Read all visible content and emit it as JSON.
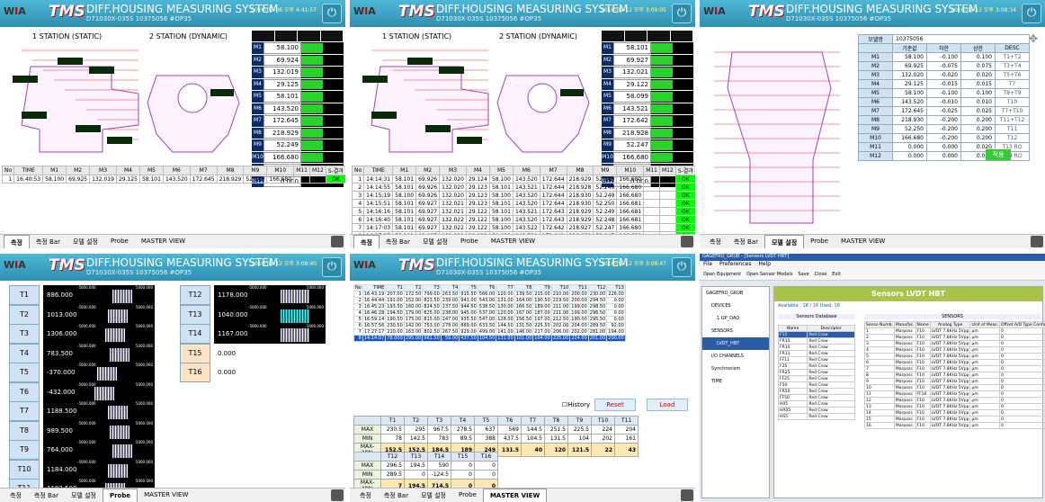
{
  "app": {
    "logo": "WIA",
    "tms": "TMS",
    "title": "DIFF.HOUSING MEASURING SYSTEM",
    "subtitle": "D71030X-035S 10375056 #OP35",
    "power": "⏻"
  },
  "tabs": [
    "측정",
    "측정 Bar",
    "모델 설정",
    "Probe",
    "MASTER VIEW"
  ],
  "p1": {
    "datetime": "2016-02-06 오후 4:41:57",
    "station1": "1 STATION (STATIC)",
    "station2": "2 STATION (DYNAMIC)",
    "mlabels": [
      "M1",
      "M2",
      "M3",
      "M4",
      "M5",
      "M6",
      "M7",
      "M8",
      "M9",
      "M10",
      "M11",
      "M12"
    ],
    "mvalues": [
      "58.100",
      "69.924",
      "132.019",
      "29.125",
      "58.101",
      "143.520",
      "172.645",
      "218.929",
      "52.249",
      "166.680",
      "0.000",
      "0.000"
    ],
    "fill": [
      0.5,
      0.5,
      0.5,
      0.5,
      0.5,
      0.5,
      0.5,
      0.5,
      0.5,
      0.5,
      0,
      0
    ],
    "hdr": [
      "No",
      "TIME",
      "M1",
      "M2",
      "M3",
      "M4",
      "M5",
      "M6",
      "M7",
      "M8",
      "M9",
      "M10",
      "M11",
      "M12",
      "S-결과",
      "D-결과"
    ],
    "rows": [
      [
        "1",
        "16:40:53",
        "58.100",
        "69.925",
        "132.019",
        "29.125",
        "58.101",
        "143.520",
        "172.645",
        "218.929",
        "52.249",
        "166.680",
        "",
        "",
        "OK",
        ""
      ]
    ]
  },
  "p2": {
    "datetime": "2016-02-12 오후 3:09:05",
    "station1": "1 STATION (STATIC)",
    "station2": "2 STATION (DYNAMIC)",
    "mvalues": [
      "58.101",
      "69.927",
      "132.021",
      "29.122",
      "58.099",
      "143.521",
      "172.642",
      "218.928",
      "52.247",
      "166.680",
      "0.000",
      "0.000"
    ],
    "fill": [
      0.5,
      0.5,
      0.5,
      0.5,
      0.5,
      0.5,
      0.5,
      0.5,
      0.5,
      0.5,
      0,
      0
    ],
    "hdr": [
      "No",
      "TIME",
      "M1",
      "M2",
      "M3",
      "M4",
      "M5",
      "M6",
      "M7",
      "M8",
      "M9",
      "M10",
      "M11",
      "M12",
      "S-결과",
      "D-결과"
    ],
    "rows": [
      [
        "1",
        "14:14:31",
        "58.101",
        "69.926",
        "132.020",
        "29.124",
        "58.100",
        "143.520",
        "172.644",
        "218.929",
        "52.249",
        "166.680",
        "",
        "",
        "OK",
        ""
      ],
      [
        "2",
        "14:14:55",
        "58.101",
        "69.926",
        "132.020",
        "29.123",
        "58.101",
        "143.521",
        "172.644",
        "218.928",
        "52.249",
        "166.680",
        "",
        "",
        "OK",
        ""
      ],
      [
        "3",
        "14:15:19",
        "58.100",
        "69.926",
        "132.020",
        "29.123",
        "58.100",
        "143.520",
        "172.644",
        "218.930",
        "52.249",
        "166.680",
        "",
        "",
        "OK",
        ""
      ],
      [
        "4",
        "14:15:51",
        "58.101",
        "69.927",
        "132.021",
        "29.123",
        "58.101",
        "143.520",
        "172.644",
        "218.930",
        "52.250",
        "166.681",
        "",
        "",
        "OK",
        ""
      ],
      [
        "5",
        "14:16:16",
        "58.101",
        "69.927",
        "132.021",
        "29.122",
        "58.101",
        "143.521",
        "172.643",
        "218.929",
        "52.249",
        "166.681",
        "",
        "",
        "OK",
        ""
      ],
      [
        "6",
        "14:16:40",
        "58.101",
        "69.927",
        "132.022",
        "29.122",
        "58.100",
        "143.520",
        "172.643",
        "218.929",
        "52.248",
        "166.681",
        "",
        "",
        "OK",
        ""
      ],
      [
        "7",
        "14:17:03",
        "58.101",
        "69.927",
        "132.022",
        "29.122",
        "58.100",
        "143.522",
        "172.642",
        "218.927",
        "52.247",
        "166.680",
        "",
        "",
        "OK",
        ""
      ],
      [
        "8",
        "14:17:27",
        "58.101",
        "69.927",
        "132.021",
        "29.122",
        "58.099",
        "143.521",
        "172.642",
        "218.928",
        "52.247",
        "166.680",
        "",
        "",
        "OK",
        ""
      ]
    ]
  },
  "p3": {
    "datetime": "2016-02-12 오후 3:08:34",
    "model_label": "모델명",
    "model": "10375056",
    "hdr": [
      "",
      "기준값",
      "하한",
      "상한",
      "DESC"
    ],
    "rows": [
      [
        "M1",
        "58.100",
        "-0.100",
        "0.100",
        "T1+T2"
      ],
      [
        "M2",
        "69.925",
        "-0.075",
        "0.075",
        "T3+T4"
      ],
      [
        "M3",
        "132.020",
        "-0.020",
        "0.020",
        "T5+T6"
      ],
      [
        "M4",
        "29.125",
        "-0.015",
        "0.015",
        "T7"
      ],
      [
        "M5",
        "58.100",
        "-0.100",
        "0.100",
        "T8+T9"
      ],
      [
        "M6",
        "143.520",
        "-0.010",
        "0.010",
        "T10"
      ],
      [
        "M7",
        "172.645",
        "-0.025",
        "0.025",
        "T7+T10"
      ],
      [
        "M8",
        "218.930",
        "-0.200",
        "0.200",
        "T11+T12"
      ],
      [
        "M9",
        "52.250",
        "-0.200",
        "0.200",
        "T11"
      ],
      [
        "M10",
        "166.680",
        "-0.200",
        "0.200",
        "T12"
      ],
      [
        "M11",
        "0.000",
        "0.000",
        "0.020",
        "T13 RO"
      ],
      [
        "M12",
        "0.000",
        "0.000",
        "0.020",
        "T14 RO"
      ]
    ],
    "apply": "적용"
  },
  "p4": {
    "datetime": "2016-02-12 오후 3:08:40",
    "scale_min": "-5000.000",
    "scale_max": "5000.000",
    "probes": [
      [
        "T1",
        "886.000"
      ],
      [
        "T2",
        "1013.000"
      ],
      [
        "T3",
        "1306.000"
      ],
      [
        "T4",
        "783.500"
      ],
      [
        "T5",
        "-370.000"
      ],
      [
        "T6",
        "-432.000"
      ],
      [
        "T7",
        "1188.500"
      ],
      [
        "T8",
        "989.500"
      ],
      [
        "T9",
        "764.000"
      ],
      [
        "T10",
        "1184.000"
      ],
      [
        "T11",
        "1183.500"
      ]
    ],
    "probes2": [
      [
        "T12",
        "1178.000"
      ],
      [
        "T13",
        "1040.000"
      ],
      [
        "T14",
        "1167.000"
      ],
      [
        "T15",
        "0.000"
      ],
      [
        "T16",
        "0.000"
      ]
    ]
  },
  "p5": {
    "datetime": "2016-02-12 오후 3:09:47",
    "hdr": [
      "No",
      "TIME",
      "T1",
      "T2",
      "T3",
      "T4",
      "T5",
      "T6",
      "T7",
      "T8",
      "T9",
      "T10",
      "T11",
      "T12",
      "T13"
    ],
    "rows": [
      [
        "1",
        "16:43:19",
        "207.00",
        "172.50",
        "799.00",
        "263.50",
        "915.50",
        "566.00",
        "120.00",
        "139.50",
        "215.00",
        "210.00",
        "200.00",
        "230.00",
        "226.00"
      ],
      [
        "2",
        "16:44:44",
        "191.00",
        "152.00",
        "823.50",
        "239.00",
        "941.00",
        "543.00",
        "131.00",
        "164.00",
        "190.50",
        "219.50",
        "200.00",
        "294.50",
        "0.00"
      ],
      [
        "3",
        "16:45:23",
        "193.50",
        "160.00",
        "824.50",
        "237.50",
        "944.50",
        "538.50",
        "130.00",
        "166.50",
        "189.00",
        "211.00",
        "199.00",
        "298.50",
        "0.00"
      ],
      [
        "4",
        "16:46:28",
        "194.50",
        "179.00",
        "825.00",
        "238.00",
        "945.00",
        "537.00",
        "120.00",
        "167.00",
        "187.00",
        "211.00",
        "199.00",
        "296.50",
        "0.00"
      ],
      [
        "5",
        "16:59:14",
        "190.50",
        "175.00",
        "815.00",
        "247.00",
        "935.50",
        "547.00",
        "128.00",
        "156.50",
        "197.00",
        "212.50",
        "190.00",
        "295.50",
        "0.00"
      ],
      [
        "6",
        "16:57:56",
        "230.50",
        "142.00",
        "753.00",
        "278.00",
        "889.00",
        "633.50",
        "144.50",
        "131.50",
        "225.50",
        "202.00",
        "204.00",
        "289.50",
        "92.00"
      ],
      [
        "7",
        "17:27:17",
        "210.00",
        "163.00",
        "802.50",
        "267.50",
        "929.00",
        "499.00",
        "141.00",
        "146.00",
        "217.00",
        "206.00",
        "202.00",
        "281.00",
        "194.00"
      ],
      [
        "8",
        "14:14:07",
        "78.000",
        "295.00",
        "961.50",
        "59.00",
        "437.50",
        "104.50",
        "131.00",
        "101.00",
        "104.00",
        "225.00",
        "224.00",
        "201.00",
        "200.00"
      ]
    ],
    "history": "History",
    "reset": "Reset",
    "load": "Load",
    "stat_hdr": [
      "",
      "T1",
      "T2",
      "T3",
      "T4",
      "T5",
      "T6",
      "T7",
      "T8",
      "T9",
      "T10",
      "T11"
    ],
    "stat": [
      [
        "MAX",
        "230.5",
        "295",
        "967.5",
        "278.5",
        "637",
        "569",
        "144.5",
        "251.5",
        "225.5",
        "224",
        "204"
      ],
      [
        "MIN",
        "78",
        "142.5",
        "783",
        "89.5",
        "388",
        "437.5",
        "104.5",
        "131.5",
        "104",
        "202",
        "161"
      ],
      [
        "MAX-MIN",
        "152.5",
        "152.5",
        "184.5",
        "189",
        "249",
        "131.5",
        "40",
        "120",
        "121.5",
        "22",
        "43"
      ]
    ],
    "stat2_hdr": [
      "",
      "T12",
      "T13",
      "T14",
      "T15",
      "T16"
    ],
    "stat2": [
      [
        "MAX",
        "296.5",
        "194.5",
        "590",
        "0",
        "0"
      ],
      [
        "MIN",
        "289.5",
        "0",
        "-124.5",
        "0",
        "0"
      ],
      [
        "MAX-MIN",
        "7",
        "194.5",
        "714.5",
        "0",
        "0"
      ]
    ]
  },
  "p6": {
    "window_title": "GAGEFRO_GRUB - [Sensors LVDT HBT]",
    "menu": [
      "File",
      "Preferences",
      "Help"
    ],
    "toolbar": [
      "Open Equipment",
      "Open Sensor Models",
      "Save",
      "Close",
      "Exit"
    ],
    "tree": [
      "GAGEFRO_GRUB",
      "DEVICES",
      "1 GP_DAQ",
      "SENSORS",
      "LVDT_HBT",
      "I/O CHANNELS",
      "Synchronism",
      "TIME"
    ],
    "title": "Sensors LVDT HBT",
    "available": "Available : 18 / 16 Used: 16",
    "db_title": "Sensors Database",
    "db_hdr": [
      "Name",
      "Descriptor"
    ],
    "db_rows": [
      [
        "F15",
        "Red Crow"
      ],
      [
        "FR15",
        "Red Crow"
      ],
      [
        "FR10",
        "Red Crow"
      ],
      [
        "FR11",
        "Red Crow"
      ],
      [
        "FF11",
        "Red Crow"
      ],
      [
        "F25",
        "Red Crow"
      ],
      [
        "FR25",
        "Red Crow"
      ],
      [
        "FF25",
        "Red Crow"
      ],
      [
        "F50",
        "Red Crow"
      ],
      [
        "FR50",
        "Red Crow"
      ],
      [
        "FF50",
        "Red Crow"
      ],
      [
        "H05",
        "Red Crow"
      ],
      [
        "HR05",
        "Red Crow"
      ],
      [
        "HS5",
        "Red Crow"
      ]
    ],
    "s_title": "SENSORS",
    "s_hdr": [
      "Senso Numb.",
      "Manufac.",
      "Name",
      "Analog Type",
      "Unit of Meas.",
      "Offset A/D Type Config.",
      "Gain Adj.",
      "Ann. Parts"
    ],
    "s_rows": [
      [
        "1",
        "Marposs",
        "F10",
        "LVDT 7.8KHz 5Vpp",
        "μm",
        "0",
        "1",
        "1"
      ],
      [
        "2",
        "Marposs",
        "F10",
        "LVDT 7.8KHz 5Vpp",
        "μm",
        "0",
        "1",
        "1"
      ],
      [
        "3",
        "Marposs",
        "F10",
        "LVDT 7.8KHz 5Vpp",
        "μm",
        "0",
        "1",
        "1"
      ],
      [
        "4",
        "Marposs",
        "F10",
        "LVDT 7.8KHz 5Vpp",
        "μm",
        "0",
        "1",
        "1"
      ],
      [
        "5",
        "Marposs",
        "F10",
        "LVDT 7.8KHz 5Vpp",
        "μm",
        "0",
        "1",
        "1"
      ],
      [
        "6",
        "Marposs",
        "F10",
        "LVDT 7.8KHz 5Vpp",
        "μm",
        "0",
        "1",
        "1"
      ],
      [
        "7",
        "Marposs",
        "F10",
        "LVDT 7.8KHz 5Vpp",
        "μm",
        "0",
        "1",
        "1"
      ],
      [
        "8",
        "Marposs",
        "F10",
        "LVDT 7.8KHz 5Vpp",
        "μm",
        "0",
        "1",
        "1"
      ],
      [
        "9",
        "Marposs",
        "F10",
        "LVDT 7.8KHz 5Vpp",
        "μm",
        "0",
        "1",
        "1"
      ],
      [
        "10",
        "Marposs",
        "F10",
        "LVDT 7.8KHz 5Vpp",
        "μm",
        "0",
        "1",
        "1"
      ],
      [
        "11",
        "Marposs",
        "FF10",
        "LVDT 7.8KHz 5Vpp",
        "μm",
        "0",
        "1",
        "1"
      ],
      [
        "12",
        "Marposs",
        "F10",
        "LVDT 7.8KHz 5Vpp",
        "μm",
        "0",
        "1",
        "1"
      ],
      [
        "13",
        "Marposs",
        "F10",
        "LVDT 7.8KHz 5Vpp",
        "μm",
        "0",
        "1",
        "1"
      ],
      [
        "14",
        "Marposs",
        "F10",
        "LVDT 7.8KHz 5Vpp",
        "μm",
        "0",
        "1",
        "1"
      ],
      [
        "15",
        "Marposs",
        "F10",
        "LVDT 7.8KHz 5Vpp",
        "μm",
        "0",
        "1",
        "1"
      ],
      [
        "16",
        "Marposs",
        "F10",
        "LVDT 7.8KHz 5Vpp",
        "μm",
        "0",
        "1",
        "1"
      ]
    ]
  }
}
